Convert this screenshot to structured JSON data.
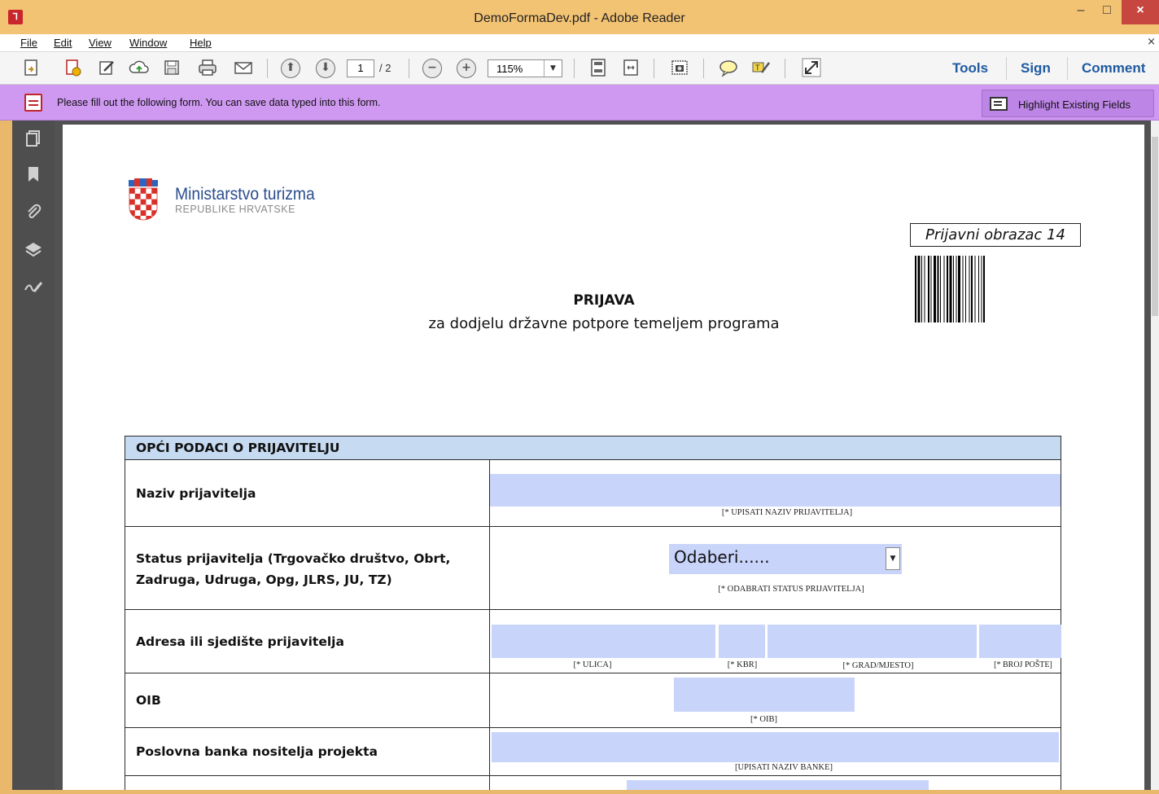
{
  "window": {
    "title": "DemoFormaDev.pdf - Adobe Reader",
    "minimize": "–",
    "maximize": "□",
    "close": "×"
  },
  "menu": {
    "items": [
      "File",
      "Edit",
      "View",
      "Window",
      "Help"
    ],
    "close_doc": "×"
  },
  "toolbar": {
    "page_current": "1",
    "page_total": "/ 2",
    "zoom": "115%",
    "links": [
      "Tools",
      "Sign",
      "Comment"
    ],
    "icons": [
      "create-pdf-icon",
      "combine-icon",
      "edit-icon",
      "cloud-upload-icon",
      "save-icon",
      "print-icon",
      "email-icon",
      "previous-page-icon",
      "next-page-icon",
      "zoom-out-icon",
      "zoom-in-icon",
      "fit-page-icon",
      "fit-width-icon",
      "snapshot-icon",
      "comment-icon",
      "highlight-icon",
      "fullscreen-icon"
    ]
  },
  "formbar": {
    "message": "Please fill out the following form. You can save data typed into this form.",
    "highlight_button": "Highlight Existing Fields"
  },
  "leftnav": {
    "icons": [
      "pages-icon",
      "bookmarks-icon",
      "attachments-icon",
      "layers-icon",
      "signatures-icon"
    ]
  },
  "document": {
    "logo": {
      "name": "Ministarstvo turizma",
      "sub": "REPUBLIKE HRVATSKE"
    },
    "form_id": "Prijavni obrazac 14",
    "heading": "PRIJAVA",
    "subheading": "za dodjelu državne potpore temeljem programa",
    "table": {
      "section_title": "OPĆI PODACI O PRIJAVITELJU",
      "rows": {
        "naziv": {
          "label": "Naziv prijavitelja",
          "hint": "[* UPISATI NAZIV PRIJAVITELJA]"
        },
        "status": {
          "label": "Status prijavitelja (Trgovačko društvo, Obrt, Zadruga, Udruga, Opg, JLRS, JU, TZ)",
          "value": "Odaberi......",
          "hint": "[* ODABRATI STATUS PRIJAVITELJA]"
        },
        "adresa": {
          "label": "Adresa ili sjedište prijavitelja",
          "hint_ulica": "[* ULICA]",
          "hint_kbr": "[* KBR]",
          "hint_grad": "[* GRAD/MJESTO]",
          "hint_posta": "[* BROJ POŠTE]"
        },
        "oib": {
          "label": "OIB",
          "hint": "[* OIB]"
        },
        "banka": {
          "label": "Poslovna banka nositelja projekta",
          "hint": "[UPISATI NAZIV BANKE]"
        }
      }
    }
  }
}
